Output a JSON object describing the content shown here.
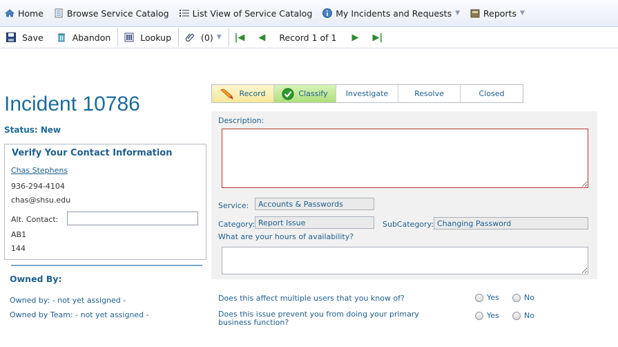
{
  "nav": {
    "home": "Home",
    "browse": "Browse Service Catalog",
    "list_view": "List View of Service Catalog",
    "my_incidents": "My Incidents and Requests",
    "reports": "Reports"
  },
  "toolbar": {
    "save": "Save",
    "abandon": "Abandon",
    "lookup": "Lookup",
    "attachments": "(0)",
    "record_position": "Record 1 of 1"
  },
  "incident": {
    "title": "Incident 10786",
    "status": "Status: New"
  },
  "contact": {
    "heading": "Verify Your Contact Information",
    "name": "Chas Stephens",
    "phone": "936-294-4104",
    "email": "chas@shsu.edu",
    "alt_contact_label": "Alt. Contact:",
    "alt_contact_value": "",
    "building": "AB1",
    "room": "144"
  },
  "owned": {
    "heading": "Owned By:",
    "owned_by": "Owned by: - not yet assigned -",
    "owned_by_team": "Owned by Team: - not yet assigned -"
  },
  "stages": [
    "Record",
    "Classify",
    "Investigate",
    "Resolve",
    "Closed"
  ],
  "form": {
    "description_label": "Description:",
    "description_value": "",
    "service_label": "Service:",
    "service_value": "Accounts & Passwords",
    "category_label": "Category:",
    "category_value": "Report Issue",
    "subcategory_label": "SubCategory:",
    "subcategory_value": "Changing Password",
    "hours_label": "What are your hours of availability?",
    "hours_value": ""
  },
  "questions": {
    "q1": "Does this affect multiple users that you know of?",
    "q2": "Does this issue prevent you from doing your primary business function?",
    "yes": "Yes",
    "no": "No"
  }
}
